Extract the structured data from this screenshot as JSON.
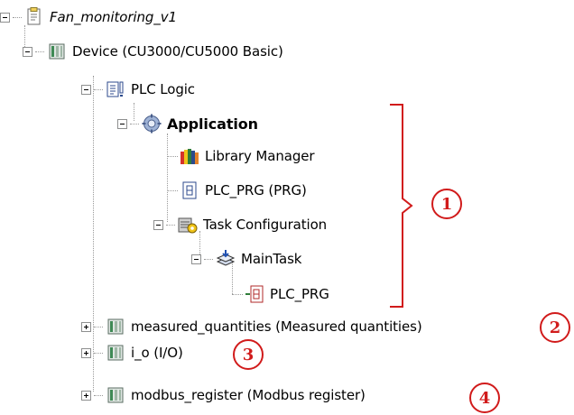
{
  "tree": {
    "project": {
      "label": "Fan_monitoring_v1",
      "icon": "project-icon"
    },
    "device": {
      "label": "Device (CU3000/CU5000 Basic)",
      "icon": "device-icon"
    },
    "plc_logic": {
      "label": "PLC Logic",
      "icon": "plc-logic-icon"
    },
    "application": {
      "label": "Application",
      "icon": "application-gear-icon"
    },
    "library_manager": {
      "label": "Library Manager",
      "icon": "library-icon"
    },
    "plc_prg": {
      "label": "PLC_PRG (PRG)",
      "icon": "program-icon"
    },
    "task_configuration": {
      "label": "Task Configuration",
      "icon": "task-config-icon"
    },
    "main_task": {
      "label": "MainTask",
      "icon": "task-icon"
    },
    "main_task_prg": {
      "label": "PLC_PRG",
      "icon": "program-call-icon"
    },
    "measured_quantities": {
      "label": "measured_quantities (Measured quantities)",
      "icon": "device-icon"
    },
    "io": {
      "label": "i_o (I/O)",
      "icon": "device-icon"
    },
    "modbus_register": {
      "label": "modbus_register (Modbus register)",
      "icon": "device-icon"
    }
  },
  "annotations": {
    "accent_color": "#d11b1b",
    "callouts": [
      "1",
      "2",
      "3",
      "4"
    ]
  }
}
